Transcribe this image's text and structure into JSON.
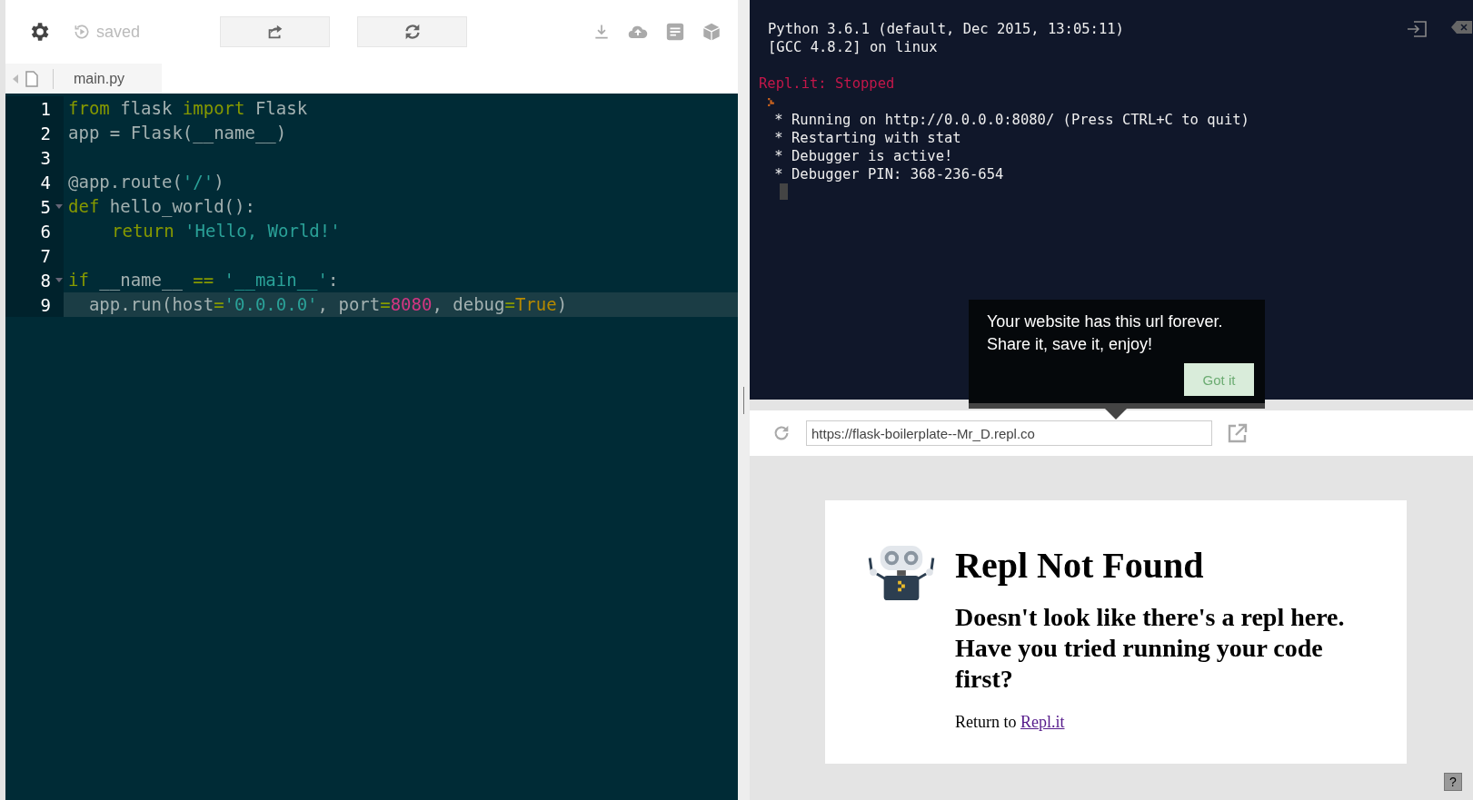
{
  "toolbar": {
    "status": "saved"
  },
  "file_tab": {
    "label": "main.py"
  },
  "code_lines": [
    {
      "number": "1",
      "foldable": false,
      "active": false,
      "tokens": [
        {
          "kind": "keyword",
          "text": "from"
        },
        {
          "kind": "plain",
          "text": " flask "
        },
        {
          "kind": "keyword",
          "text": "import"
        },
        {
          "kind": "plain",
          "text": " Flask"
        }
      ]
    },
    {
      "number": "2",
      "foldable": false,
      "active": false,
      "tokens": [
        {
          "kind": "plain",
          "text": "app = Flask(__name__)"
        }
      ]
    },
    {
      "number": "3",
      "foldable": false,
      "active": false
    },
    {
      "number": "4",
      "foldable": false,
      "active": false,
      "tokens": [
        {
          "kind": "plain",
          "text": "@app.route("
        },
        {
          "kind": "string",
          "text": "'/'"
        },
        {
          "kind": "plain",
          "text": ")"
        }
      ]
    },
    {
      "number": "5",
      "foldable": true,
      "active": false,
      "tokens": [
        {
          "kind": "keyword",
          "text": "def"
        },
        {
          "kind": "plain",
          "text": " hello_world():"
        }
      ]
    },
    {
      "number": "6",
      "foldable": false,
      "active": false,
      "indented": true,
      "tokens": [
        {
          "kind": "keyword",
          "text": "return"
        },
        {
          "kind": "string",
          "text": " 'Hello, World!'"
        }
      ]
    },
    {
      "number": "7",
      "foldable": false,
      "active": false
    },
    {
      "number": "8",
      "foldable": true,
      "active": false,
      "tokens": [
        {
          "kind": "keyword",
          "text": "if"
        },
        {
          "kind": "plain",
          "text": " __name__ "
        },
        {
          "kind": "op",
          "text": "=="
        },
        {
          "kind": "string",
          "text": " '__main__'"
        },
        {
          "kind": "plain",
          "text": ":"
        }
      ]
    },
    {
      "number": "9",
      "foldable": false,
      "active": true,
      "tokens": [
        {
          "kind": "plain",
          "text": "  app.run(host"
        },
        {
          "kind": "op",
          "text": "="
        },
        {
          "kind": "string",
          "text": "'0.0.0.0'"
        },
        {
          "kind": "plain",
          "text": ", port"
        },
        {
          "kind": "op",
          "text": "="
        },
        {
          "kind": "number",
          "text": "8080"
        },
        {
          "kind": "plain",
          "text": ", debug"
        },
        {
          "kind": "op",
          "text": "="
        },
        {
          "kind": "const",
          "text": "True"
        },
        {
          "kind": "plain",
          "text": ")"
        }
      ]
    }
  ],
  "terminal_lines": [
    {
      "kind": "info",
      "text": "Python 3.6.1 (default, Dec 2015, 13:05:11)"
    },
    {
      "kind": "info",
      "text": "[GCC 4.8.2] on linux"
    },
    {
      "kind": "blank"
    },
    {
      "kind": "error",
      "text": "Repl.it: Stopped"
    },
    {
      "kind": "prompt"
    },
    {
      "kind": "output",
      "text": " * Running on http://0.0.0.0:8080/ (Press CTRL+C to quit)"
    },
    {
      "kind": "output",
      "text": " * Restarting with stat"
    },
    {
      "kind": "output",
      "text": " * Debugger is active!"
    },
    {
      "kind": "output",
      "text": " * Debugger PIN: 368-236-654"
    },
    {
      "kind": "cursor"
    }
  ],
  "tooltip": {
    "text": "Your website has this url forever. Share it, save it, enjoy!",
    "button": "Got it"
  },
  "url_bar": {
    "value": "https://flask-boilerplate--Mr_D.repl.co"
  },
  "preview": {
    "title": "Repl Not Found",
    "message": "Doesn't look like there's a repl here. Have you tried running your code first?",
    "return_text": "Return to",
    "return_link": "Repl.it"
  },
  "help_button": "?"
}
